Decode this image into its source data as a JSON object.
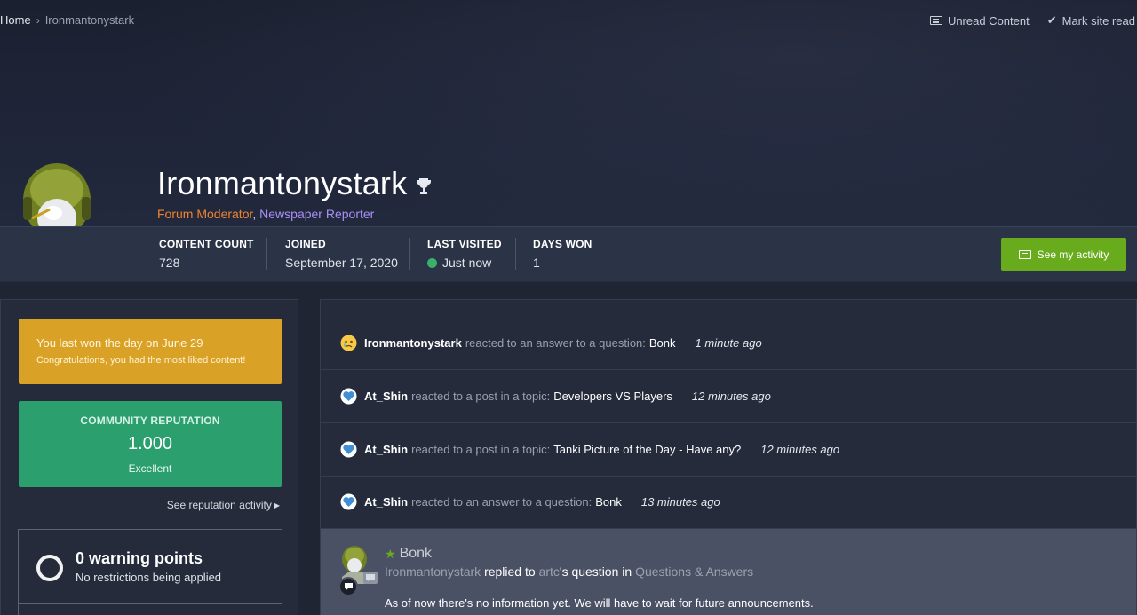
{
  "breadcrumb": {
    "home": "Home",
    "current": "Ironmantonystark"
  },
  "top_actions": {
    "unread": "Unread Content",
    "mark_read": "Mark site read"
  },
  "profile": {
    "name": "Ironmantonystark",
    "group_moderator": "Forum Moderator",
    "group_separator": ",",
    "group_reporter": "Newspaper Reporter",
    "colors": {
      "moderator": "#f0822f",
      "reporter": "#a98ff5"
    }
  },
  "stats": {
    "content_count_label": "CONTENT COUNT",
    "content_count": "728",
    "joined_label": "JOINED",
    "joined": "September 17, 2020",
    "last_visited_label": "LAST VISITED",
    "last_visited": "Just now",
    "days_won_label": "DAYS WON",
    "days_won": "1"
  },
  "activity_button": "See my activity",
  "sidebar": {
    "day_won_line1": "You last won the day on June 29",
    "day_won_line2": "Congratulations, you had the most liked content!",
    "reputation_label": "COMMUNITY REPUTATION",
    "reputation_value": "1.000",
    "reputation_desc": "Excellent",
    "reputation_link": "See reputation activity",
    "warning_title": "0 warning points",
    "warning_sub": "No restrictions being applied"
  },
  "feed": {
    "rows": [
      {
        "user": "Ironmantonystark",
        "action": "reacted to an answer to a question:",
        "item": "Bonk",
        "time": "1 minute ago",
        "reaction": "sad"
      },
      {
        "user": "At_Shin",
        "action": "reacted to a post in a topic:",
        "item": "Developers VS Players",
        "time": "12 minutes ago",
        "reaction": "love"
      },
      {
        "user": "At_Shin",
        "action": "reacted to a post in a topic:",
        "item": "Tanki Picture of the Day - Have any?",
        "time": "12 minutes ago",
        "reaction": "love"
      },
      {
        "user": "At_Shin",
        "action": "reacted to an answer to a question:",
        "item": "Bonk",
        "time": "13 minutes ago",
        "reaction": "love"
      }
    ],
    "post": {
      "title": "Bonk",
      "user": "Ironmantonystark",
      "replied_to": "replied to",
      "target": "artc",
      "question_in": "'s question in",
      "forum": "Questions & Answers",
      "body": "As of now there's no information yet. We will have to wait for future announcements."
    }
  },
  "colors": {
    "accent_green": "#68ac1e",
    "reputation_green": "#2b9f6e",
    "day_won_gold": "#d9a125"
  }
}
